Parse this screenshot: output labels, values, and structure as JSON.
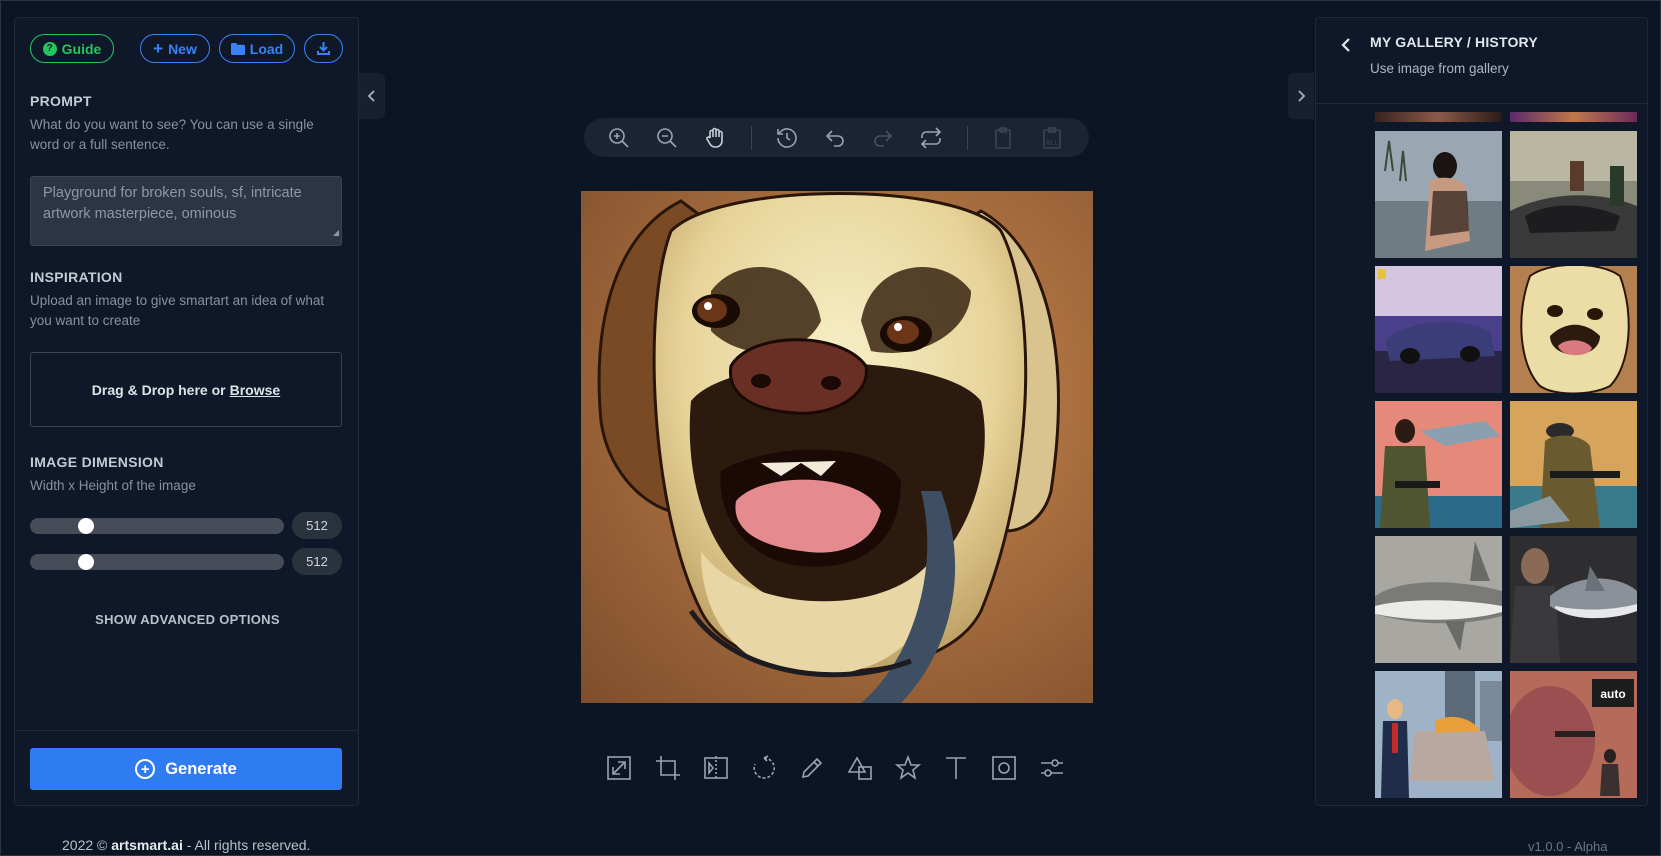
{
  "header_buttons": {
    "guide": "Guide",
    "new": "New",
    "load": "Load"
  },
  "prompt": {
    "title": "PROMPT",
    "description": "What do you want to see? You can use a single word or a full sentence.",
    "placeholder": "Playground for broken souls, sf, intricate artwork masterpiece, ominous"
  },
  "inspiration": {
    "title": "INSPIRATION",
    "description": "Upload an image to give smartart an idea of what you want to create",
    "drop_text": "Drag & Drop here or",
    "browse": "Browse"
  },
  "dimension": {
    "title": "IMAGE DIMENSION",
    "description": "Width x Height of the image",
    "width": "512",
    "height": "512",
    "width_fraction": 0.22,
    "height_fraction": 0.22
  },
  "advanced": "SHOW ADVANCED OPTIONS",
  "generate": "Generate",
  "gallery": {
    "title": "MY GALLERY / HISTORY",
    "subtitle": "Use image from gallery"
  },
  "footer": {
    "year": "2022 ©",
    "brand": "artsmart.ai",
    "rights": "- All rights reserved.",
    "version": "v1.0.0 - Alpha"
  },
  "colors": {
    "accent_blue": "#2e7bf2",
    "guide_green": "#22c55e",
    "background": "#0c1524"
  }
}
